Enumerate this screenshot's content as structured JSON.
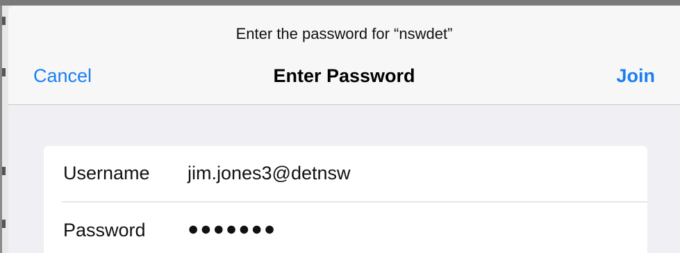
{
  "prompt": "Enter the password for “nswdet”",
  "navbar": {
    "cancel_label": "Cancel",
    "title": "Enter Password",
    "join_label": "Join"
  },
  "form": {
    "username_label": "Username",
    "username_value": "jim.jones3@detnsw",
    "password_label": "Password",
    "password_mask": "●●●●●●●"
  },
  "colors": {
    "accent": "#1a7ff0",
    "sheet_bg": "#efeff4",
    "navbar_bg": "#f7f7f7"
  }
}
